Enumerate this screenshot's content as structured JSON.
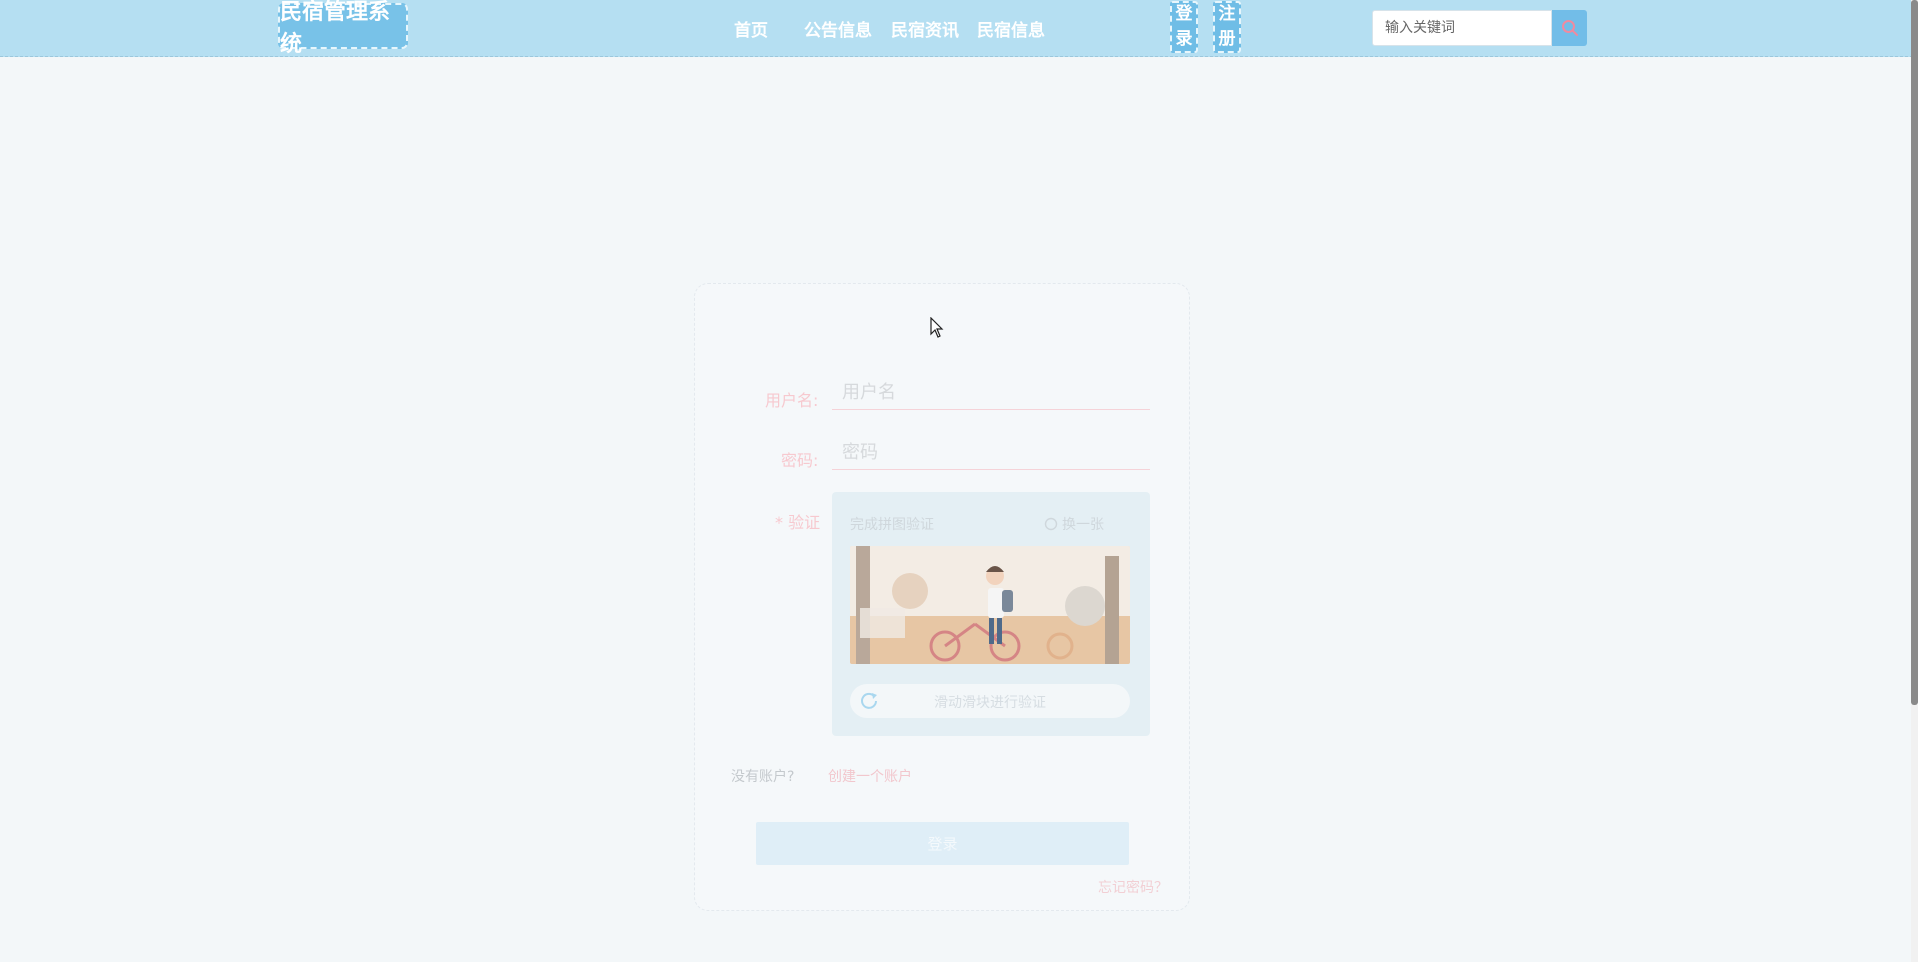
{
  "header": {
    "logo": "民宿管理系统",
    "nav": [
      "首页",
      "公告信息",
      "民宿资讯",
      "民宿信息"
    ],
    "login": [
      "登",
      "录"
    ],
    "register": [
      "注",
      "册"
    ],
    "search_placeholder": "输入关键词"
  },
  "form": {
    "username_label": "用户名:",
    "username_placeholder": "用户名",
    "password_label": "密码:",
    "password_placeholder": "密码",
    "verify_label": "* 验证",
    "verify_title": "完成拼图验证",
    "verify_refresh": "换一张",
    "slider_text": "滑动滑块进行验证",
    "no_account": "没有账户?",
    "create_account": "创建一个账户",
    "login_button": "登录",
    "forgot": "忘记密码？"
  },
  "colors": {
    "header_bg": "#b5dff2",
    "accent": "#72bde8",
    "label_pink": "#f7c9cf"
  }
}
